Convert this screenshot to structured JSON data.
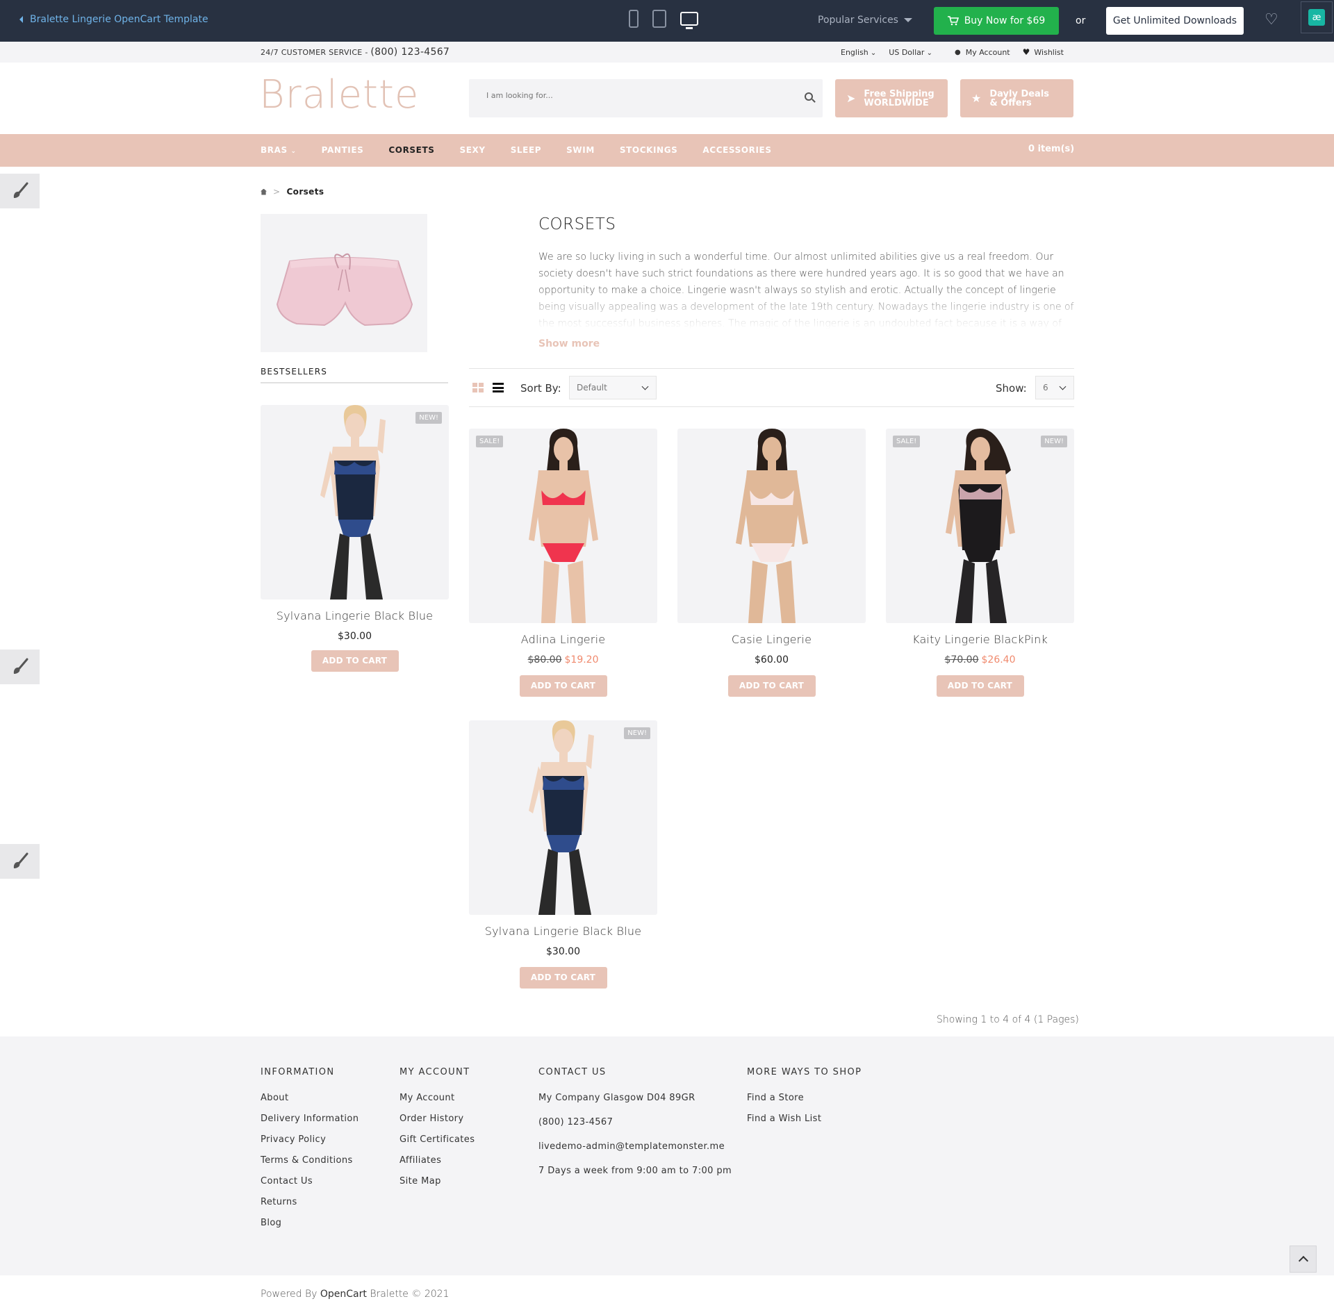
{
  "demo_bar": {
    "back_link": "Bralette Lingerie OpenCart Template",
    "popular_services": "Popular Services",
    "buy_now": "Buy Now for $69",
    "or": "or",
    "unlimited": "Get Unlimited Downloads",
    "badge_text": "æ"
  },
  "util_bar": {
    "customer_service": "24/7 CUSTOMER SERVICE - ",
    "phone": "(800) 123-4567",
    "language": "English",
    "currency": "US Dollar",
    "account": "My Account",
    "wishlist": "Wishlist"
  },
  "header": {
    "logo": "Bralette",
    "search_placeholder": "I am looking for...",
    "promo1": [
      "Free Shipping",
      "WORLDWIDE"
    ],
    "promo2": [
      "Dayly Deals",
      "& Offers"
    ]
  },
  "nav": {
    "items": [
      "BRAS",
      "PANTIES",
      "CORSETS",
      "SEXY",
      "SLEEP",
      "SWIM",
      "STOCKINGS",
      "ACCESSORIES"
    ],
    "active": "CORSETS",
    "cart": "0 item(s)"
  },
  "breadcrumb": {
    "current": "Corsets",
    "separator": ">"
  },
  "sidebar": {
    "bestsellers_title": "BESTSELLERS",
    "product": {
      "name": "Sylvana Lingerie Black Blue",
      "price": "$30.00",
      "badge": "NEW!",
      "cta": "ADD TO CART"
    }
  },
  "category": {
    "title": "CORSETS",
    "description": "We are so lucky living in such a wonderful time. Our almost unlimited abilities give us a real freedom. Our society doesn't have such strict foundations as there were hundred years ago. It is so good that we have an opportunity to make a choice. Lingerie wasn't always so stylish and erotic. Actually the concept of lingerie being visually appealing was a development of the late 19th century. Nowadays the lingerie industry is one of the most successful business spheres. The magic of the lingerie is an undoubted fact because it is a way of self",
    "show_more": "Show more"
  },
  "toolbar": {
    "sort_label": "Sort By:",
    "sort_value": "Default",
    "show_label": "Show:",
    "show_value": "6"
  },
  "products": [
    {
      "name": "Adlina Lingerie",
      "old_price": "$80.00",
      "price": "$19.20",
      "sale": "SALE!",
      "new": "",
      "cta": "ADD TO CART"
    },
    {
      "name": "Casie Lingerie",
      "old_price": "",
      "price": "$60.00",
      "sale": "",
      "new": "",
      "cta": "ADD TO CART"
    },
    {
      "name": "Kaity Lingerie BlackPink",
      "old_price": "$70.00",
      "price": "$26.40",
      "sale": "SALE!",
      "new": "NEW!",
      "cta": "ADD TO CART"
    },
    {
      "name": "Sylvana Lingerie Black Blue",
      "old_price": "",
      "price": "$30.00",
      "sale": "",
      "new": "NEW!",
      "cta": "ADD TO CART"
    }
  ],
  "pagination": {
    "showing": "Showing 1 to 4 of 4 (1 Pages)"
  },
  "footer": {
    "information": {
      "title": "INFORMATION",
      "links": [
        "About",
        "Delivery Information",
        "Privacy Policy",
        "Terms & Conditions",
        "Contact Us",
        "Returns",
        "Blog"
      ]
    },
    "account": {
      "title": "MY ACCOUNT",
      "links": [
        "My Account",
        "Order History",
        "Gift Certificates",
        "Affiliates",
        "Site Map"
      ]
    },
    "contact": {
      "title": "CONTACT US",
      "lines": [
        "My Company Glasgow D04 89GR",
        "(800) 123-4567",
        "livedemo-admin@templatemonster.me",
        "7 Days a week from 9:00 am to 7:00 pm"
      ]
    },
    "more": {
      "title": "MORE WAYS TO SHOP",
      "links": [
        "Find a Store",
        "Find a Wish List"
      ]
    },
    "copyright_prefix": "Powered By ",
    "copyright_link": "OpenCart",
    "copyright_suffix": " Bralette © 2021"
  },
  "colors": {
    "accent": "#e8c4b7",
    "dark_bar": "#283141",
    "buy_green": "#22b14c",
    "sale_price": "#f08a6e"
  },
  "icons": [
    "chevron-left-icon",
    "phone-icon",
    "tablet-icon",
    "desktop-icon",
    "cart-icon",
    "heart-icon",
    "user-icon",
    "search-icon",
    "paper-plane-icon",
    "star-icon",
    "home-icon",
    "grid-view-icon",
    "list-view-icon",
    "brush-icon",
    "arrow-up-icon"
  ]
}
